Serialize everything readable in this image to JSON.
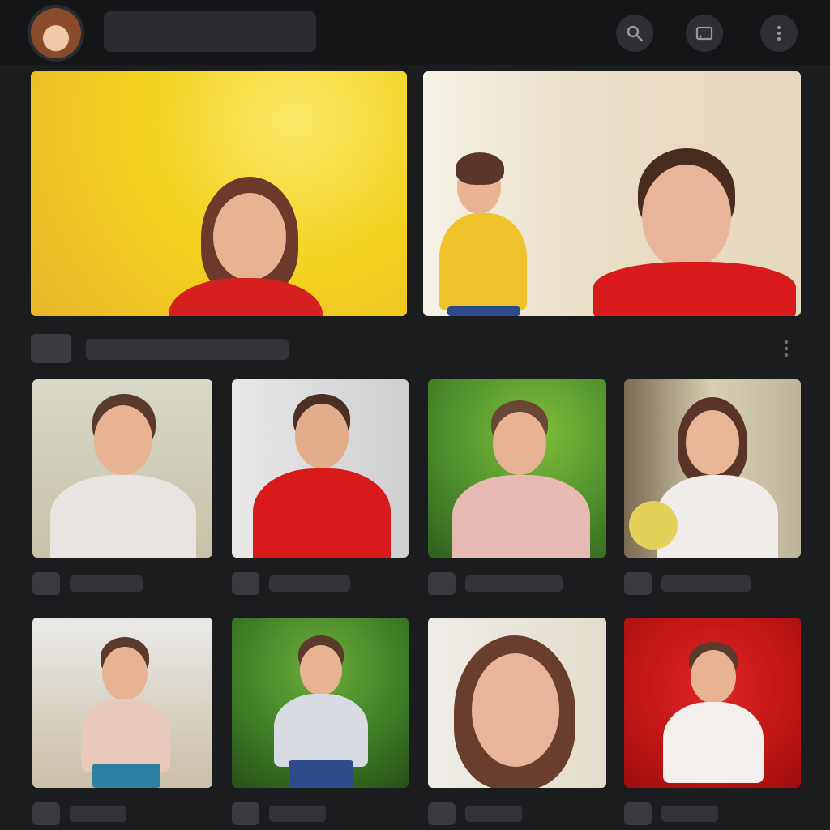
{
  "header": {
    "avatar_icon": "channel-avatar",
    "title": "",
    "icons": [
      "search-icon",
      "cast-icon",
      "more-icon"
    ]
  },
  "hero": {
    "videos": [
      {
        "name": "hero-video-1",
        "background": "yellow"
      },
      {
        "name": "hero-video-2",
        "background": "beige"
      }
    ],
    "meta_label": "",
    "more_icon": "more-vertical-icon"
  },
  "grid": {
    "rows": [
      [
        {
          "label": ""
        },
        {
          "label": ""
        },
        {
          "label": ""
        },
        {
          "label": ""
        }
      ],
      [
        {
          "label": ""
        },
        {
          "label": ""
        },
        {
          "label": ""
        },
        {
          "label": ""
        }
      ]
    ]
  },
  "colors": {
    "background": "#1b1c1e",
    "topbar": "#141517",
    "placeholder": "#333438"
  }
}
